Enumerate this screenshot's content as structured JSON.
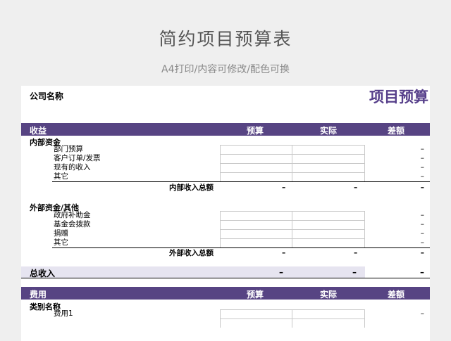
{
  "page": {
    "title": "简约项目预算表",
    "subtitle": "A4打印/内容可修改/配色可换"
  },
  "sheet": {
    "company_label": "公司名称",
    "doc_title": "项目预算",
    "dash": "–",
    "income": {
      "header": {
        "label": "收益",
        "col1": "预算",
        "col2": "实际",
        "col3": "差额"
      },
      "internal": {
        "title": "内部资金",
        "items": [
          "部门预算",
          "客户订单/发票",
          "现有的收入",
          "其它"
        ],
        "subtotal_label": "内部收入总额"
      },
      "external": {
        "title": "外部资金/其他",
        "items": [
          "政府补助金",
          "基金会拨款",
          "捐赠",
          "其它"
        ],
        "subtotal_label": "外部收入总额"
      },
      "total_label": "总收入"
    },
    "expenses": {
      "header": {
        "label": "费用",
        "col1": "预算",
        "col2": "实际",
        "col3": "差额"
      },
      "category": {
        "title": "类别名称",
        "items": [
          "费用1"
        ]
      }
    }
  },
  "colors": {
    "accent": "#574483",
    "title_purple": "#57408b",
    "total_shade": "#e6e4f0"
  }
}
